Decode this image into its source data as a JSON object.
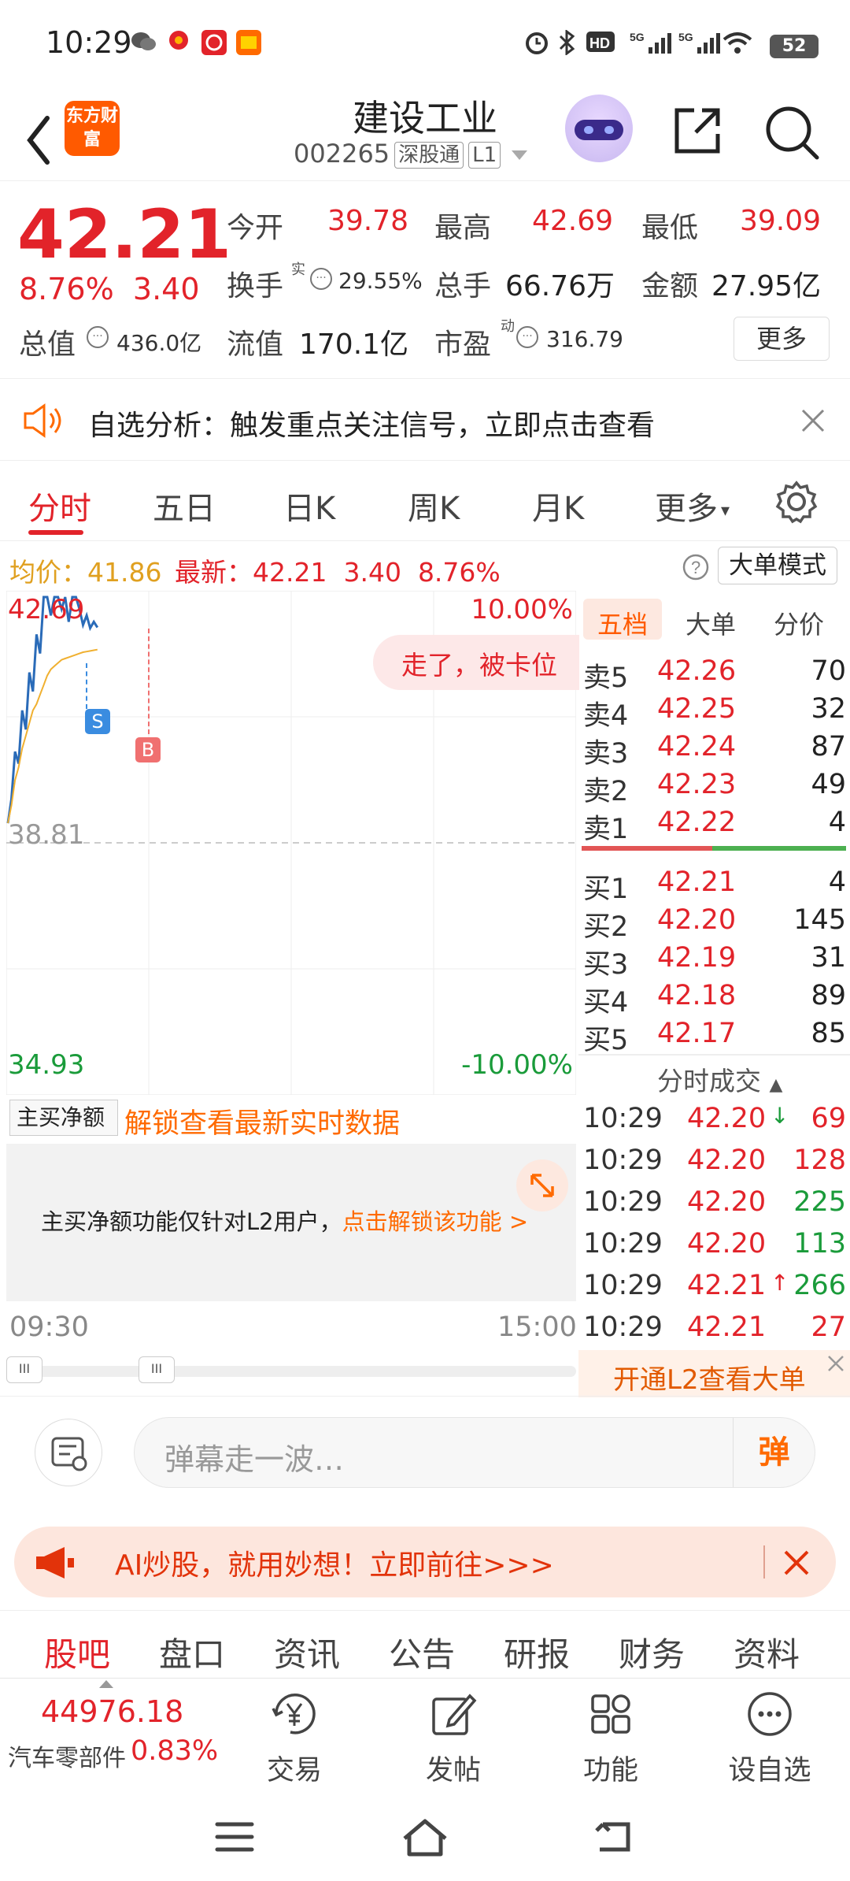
{
  "status_bar": {
    "time": "10:29",
    "battery": "52"
  },
  "header": {
    "title": "建设工业",
    "code": "002265",
    "tag1": "深股通",
    "tag2": "L1",
    "logo": "东方财富"
  },
  "quote": {
    "price": "42.21",
    "change_pct": "8.76%",
    "change": "3.40",
    "open_label": "今开",
    "open": "39.78",
    "high_label": "最高",
    "high": "42.69",
    "low_label": "最低",
    "low": "39.09",
    "turnover_label": "换手",
    "turnover_sup": "实",
    "turnover": "29.55%",
    "volume_label": "总手",
    "volume": "66.76万",
    "amount_label": "金额",
    "amount": "27.95亿",
    "mktcap_label": "总值",
    "mktcap": "436.0亿",
    "float_label": "流值",
    "float": "170.1亿",
    "pe_label": "市盈",
    "pe_sup": "动",
    "pe": "316.79",
    "more": "更多"
  },
  "notice": {
    "text": "自选分析：触发重点关注信号，立即点击查看"
  },
  "tabs": [
    "分时",
    "五日",
    "日K",
    "周K",
    "月K",
    "更多"
  ],
  "avg_row": {
    "avg_label": "均价：",
    "avg": "41.86",
    "latest_label": "最新：",
    "latest": "42.21",
    "chg": "3.40",
    "pct": "8.76%",
    "mode_btn": "大单模式"
  },
  "chart": {
    "y_top": "42.69",
    "y_mid": "38.81",
    "y_bottom": "34.93",
    "pct_top": "10.00%",
    "pct_bottom": "-10.00%",
    "marker_s": "S",
    "marker_b": "B",
    "bubble": "走了，被卡位",
    "time_start": "09:30",
    "time_end": "15:00"
  },
  "chart_data": {
    "type": "line",
    "ylim": [
      34.93,
      42.69
    ],
    "series": [
      {
        "name": "",
        "values": [
          39.12,
          39.5,
          40.25,
          40.06,
          40.9,
          40.6,
          41.5,
          41.2,
          42.1,
          41.8,
          42.69,
          42.69,
          42.4,
          42.69,
          42.69,
          42.5,
          42.69,
          42.3,
          42.69,
          42.69,
          42.5,
          42.25,
          42.4,
          42.2,
          42.3,
          42.21
        ]
      },
      {
        "name": "",
        "values": [
          39.12,
          39.4,
          39.8,
          40.0,
          40.3,
          40.5,
          40.7,
          40.9,
          41.0,
          41.15,
          41.3,
          41.45,
          41.55,
          41.6,
          41.65,
          41.7,
          41.72,
          41.74,
          41.76,
          41.78,
          41.8,
          41.82,
          41.83,
          41.84,
          41.85,
          41.86
        ]
      }
    ]
  },
  "book": {
    "tabs": [
      "五档",
      "大单",
      "分价"
    ],
    "asks": [
      {
        "label": "卖5",
        "price": "42.26",
        "vol": "70"
      },
      {
        "label": "卖4",
        "price": "42.25",
        "vol": "32"
      },
      {
        "label": "卖3",
        "price": "42.24",
        "vol": "87"
      },
      {
        "label": "卖2",
        "price": "42.23",
        "vol": "49"
      },
      {
        "label": "卖1",
        "price": "42.22",
        "vol": "4"
      }
    ],
    "bids": [
      {
        "label": "买1",
        "price": "42.21",
        "vol": "4"
      },
      {
        "label": "买2",
        "price": "42.20",
        "vol": "145"
      },
      {
        "label": "买3",
        "price": "42.19",
        "vol": "31"
      },
      {
        "label": "买4",
        "price": "42.18",
        "vol": "89"
      },
      {
        "label": "买5",
        "price": "42.17",
        "vol": "85"
      }
    ],
    "ticks_title": "分时成交",
    "ticks": [
      {
        "time": "10:29",
        "price": "42.20",
        "arrow": "↓",
        "vol": "69",
        "dir": "sell"
      },
      {
        "time": "10:29",
        "price": "42.20",
        "arrow": "",
        "vol": "128",
        "dir": "sell"
      },
      {
        "time": "10:29",
        "price": "42.20",
        "arrow": "",
        "vol": "225",
        "dir": "buy"
      },
      {
        "time": "10:29",
        "price": "42.20",
        "arrow": "",
        "vol": "113",
        "dir": "buy"
      },
      {
        "time": "10:29",
        "price": "42.21",
        "arrow": "↑",
        "vol": "266",
        "dir": "buy"
      },
      {
        "time": "10:29",
        "price": "42.21",
        "arrow": "",
        "vol": "27",
        "dir": "sell"
      }
    ],
    "l2_bar": "开通L2查看大单"
  },
  "main_buy": {
    "select": "主买净额",
    "unlock": "解锁查看最新实时数据",
    "panel_text": "主买净额功能仅针对L2用户，",
    "panel_link": "点击解锁该功能 >"
  },
  "comment": {
    "placeholder": "弹幕走一波…",
    "send": "弹"
  },
  "ai_banner": {
    "text": "AI炒股，就用妙想！立即前往>>>"
  },
  "subtabs": [
    "股吧",
    "盘口",
    "资讯",
    "公告",
    "研报",
    "财务",
    "资料"
  ],
  "toolbar": {
    "index_value": "44976.18",
    "index_name": "汽车零部件",
    "index_pct": "0.83%",
    "items": [
      "交易",
      "发帖",
      "功能",
      "设自选"
    ]
  },
  "colors": {
    "up": "#e2232a",
    "down": "#1a9b3a",
    "accent": "#ff6a00",
    "price_line": "#2a6bb8",
    "avg_line": "#f0b030"
  }
}
